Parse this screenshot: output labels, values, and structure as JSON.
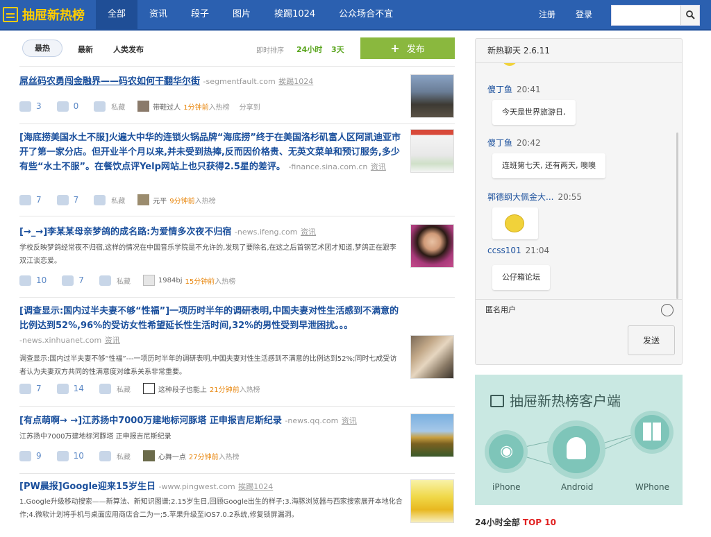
{
  "header": {
    "logo_text": "抽屉新热榜",
    "nav": [
      "全部",
      "资讯",
      "段子",
      "图片",
      "挨踢1024",
      "公众场合不宜"
    ],
    "register": "注册",
    "login": "登录",
    "search_placeholder": ""
  },
  "sortbar": {
    "hot": "最热",
    "newest": "最新",
    "human": "人类发布",
    "sort_label": "即时排序",
    "h24": "24小时",
    "d3": "3天",
    "publish": "发布"
  },
  "items": [
    {
      "title": "屌丝码农勇闯金融界——码农如何干翻华尔街",
      "source": "-segmentfault.com",
      "category": "挨踢1024",
      "desc": "",
      "up": "3",
      "comments": "0",
      "fav": "私藏",
      "user": "带鞋过人",
      "time": "1分钟前",
      "time_suffix": "入热榜",
      "share": "分享到"
    },
    {
      "title": "[海底捞美国水土不服]火遍大中华的连锁火锅品牌“海底捞”终于在美国洛杉矶富人区阿凯迪亚市开了第一家分店。但开业半个月以来,并未受到热捧,反而因价格贵、无英文菜单和预订服务,多少有些“水土不服”。在餐饮点评Yelp网站上也只获得2.5星的差评。",
      "source": "-finance.sina.com.cn",
      "category": "资讯",
      "desc": "",
      "up": "7",
      "comments": "7",
      "fav": "私藏",
      "user": "元平",
      "time": "9分钟前",
      "time_suffix": "入热榜",
      "share": ""
    },
    {
      "title": "[→_→]李某某母亲梦鸽的成名路:为爱情多次夜不归宿",
      "source": "-news.ifeng.com",
      "category": "资讯",
      "desc": "学校反映梦鸽经常夜不归宿,这样的情况在中国音乐学院是不允许的,发现了要除名,在这之后首钢艺术团才知道,梦鸽正在跟李双江谈恋爱。",
      "up": "10",
      "comments": "7",
      "fav": "私藏",
      "user": "1984bj",
      "time": "15分钟前",
      "time_suffix": "入热榜",
      "share": ""
    },
    {
      "title": "[调查显示:国内过半夫妻不够“性福”]一项历时半年的调研表明,中国夫妻对性生活感到不满意的比例达到52%,96%的受访女性希望延长性生活时间,32%的男性受到早泄困扰。。。",
      "source": "-news.xinhuanet.com",
      "category": "资讯",
      "desc": "调查显示:国内过半夫妻不够“性福”---一项历时半年的调研表明,中国夫妻对性生活感到不满意的比例达到52%;同时七成受访者认为夫妻双方共同的性满意度对维系关系非常重要。",
      "up": "7",
      "comments": "14",
      "fav": "私藏",
      "user": "这种段子也能上",
      "time": "21分钟前",
      "time_suffix": "入热榜",
      "share": ""
    },
    {
      "title": "[有点萌啊→ →]江苏扬中7000万建地标河豚塔  正申报吉尼斯纪录",
      "source": "-news.qq.com",
      "category": "资讯",
      "desc": "江苏扬中7000万建地标河豚塔 正申报吉尼斯纪录",
      "up": "9",
      "comments": "10",
      "fav": "私藏",
      "user": "心舞一点",
      "time": "27分钟前",
      "time_suffix": "入热榜",
      "share": ""
    },
    {
      "title": "[PW晨报]Google迎来15岁生日",
      "source": "-www.pingwest.com",
      "category": "挨踢1024",
      "desc": "1.Google升级移动搜索——新算法、新知识图谱;2.15岁生日,回顾Google出生的样子;3.海豚浏览器与西家搜索展开本地化合作;4.微软计划将手机与桌面应用商店合二为一;5.苹果升级至iOS7.0.2系统,修复锁屏漏洞。",
      "up": "",
      "comments": "",
      "fav": "",
      "user": "",
      "time": "",
      "time_suffix": "",
      "share": ""
    }
  ],
  "chat": {
    "title": "新热聊天 2.6.11",
    "messages": [
      {
        "name": "傻丁鱼",
        "time": "20:41",
        "text": "今天是世界旅游日,"
      },
      {
        "name": "傻丁鱼",
        "time": "20:42",
        "text": "连班第七天, 还有两天, 噢噢"
      },
      {
        "name": "郭德纲大佩金大...",
        "time": "20:55",
        "text": ""
      },
      {
        "name": "ccss101",
        "time": "21:04",
        "text": "公仔箱论坛"
      }
    ],
    "anon": "匿名用户",
    "send": "发送"
  },
  "promo": {
    "title": "抽屉新热榜客户端",
    "iphone": "iPhone",
    "android": "Android",
    "wphone": "WPhone"
  },
  "top10": {
    "prefix": "24小时全部 ",
    "highlight": "TOP 10"
  },
  "colors": {
    "brand_blue": "#2b60b0",
    "logo_yellow": "#ffcc00",
    "publish_green": "#8ab83e",
    "time_orange": "#e8860c"
  }
}
